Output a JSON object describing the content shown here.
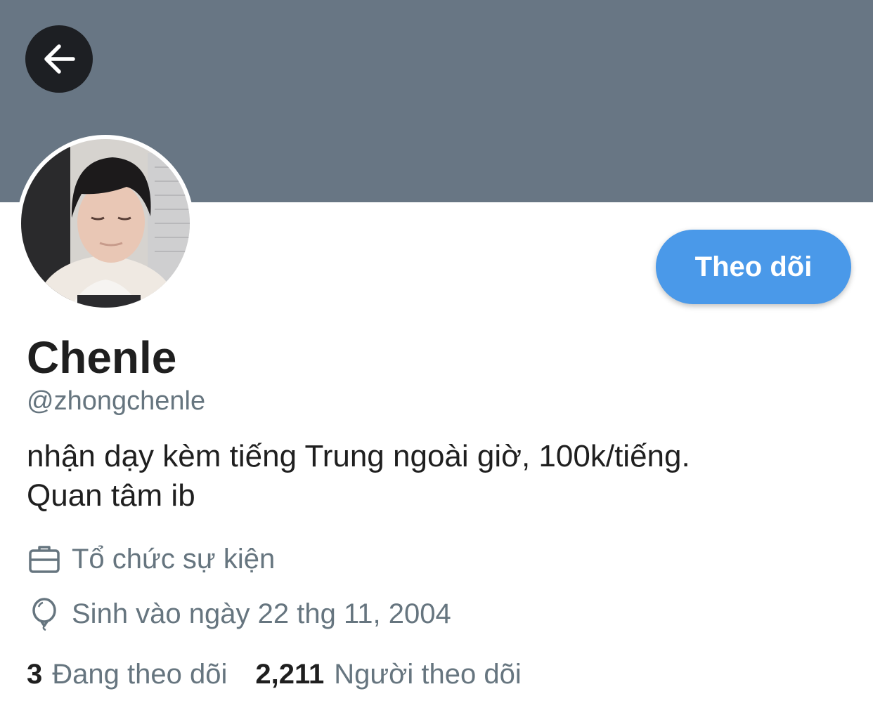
{
  "header": {
    "banner_color": "#687684",
    "back_icon": "arrow-left-icon"
  },
  "profile": {
    "avatar_icon": "profile-photo",
    "follow_label": "Theo dõi",
    "name": "Chenle",
    "handle": "@zhongchenle",
    "bio_line1": "nhận dạy kèm tiếng Trung ngoài giờ, 100k/tiếng.",
    "bio_line2": "Quan tâm ib",
    "profession_icon": "briefcase-icon",
    "profession": "Tổ chức sự kiện",
    "birthday_icon": "balloon-icon",
    "birthday": "Sinh vào ngày 22 thg 11, 2004"
  },
  "stats": {
    "following_count": "3",
    "following_label": "Đang theo dõi",
    "followers_count": "2,211",
    "followers_label": "Người theo dõi"
  },
  "colors": {
    "accent": "#4a99e9",
    "secondary_text": "#66757f",
    "primary_text": "#1f1f1f"
  }
}
